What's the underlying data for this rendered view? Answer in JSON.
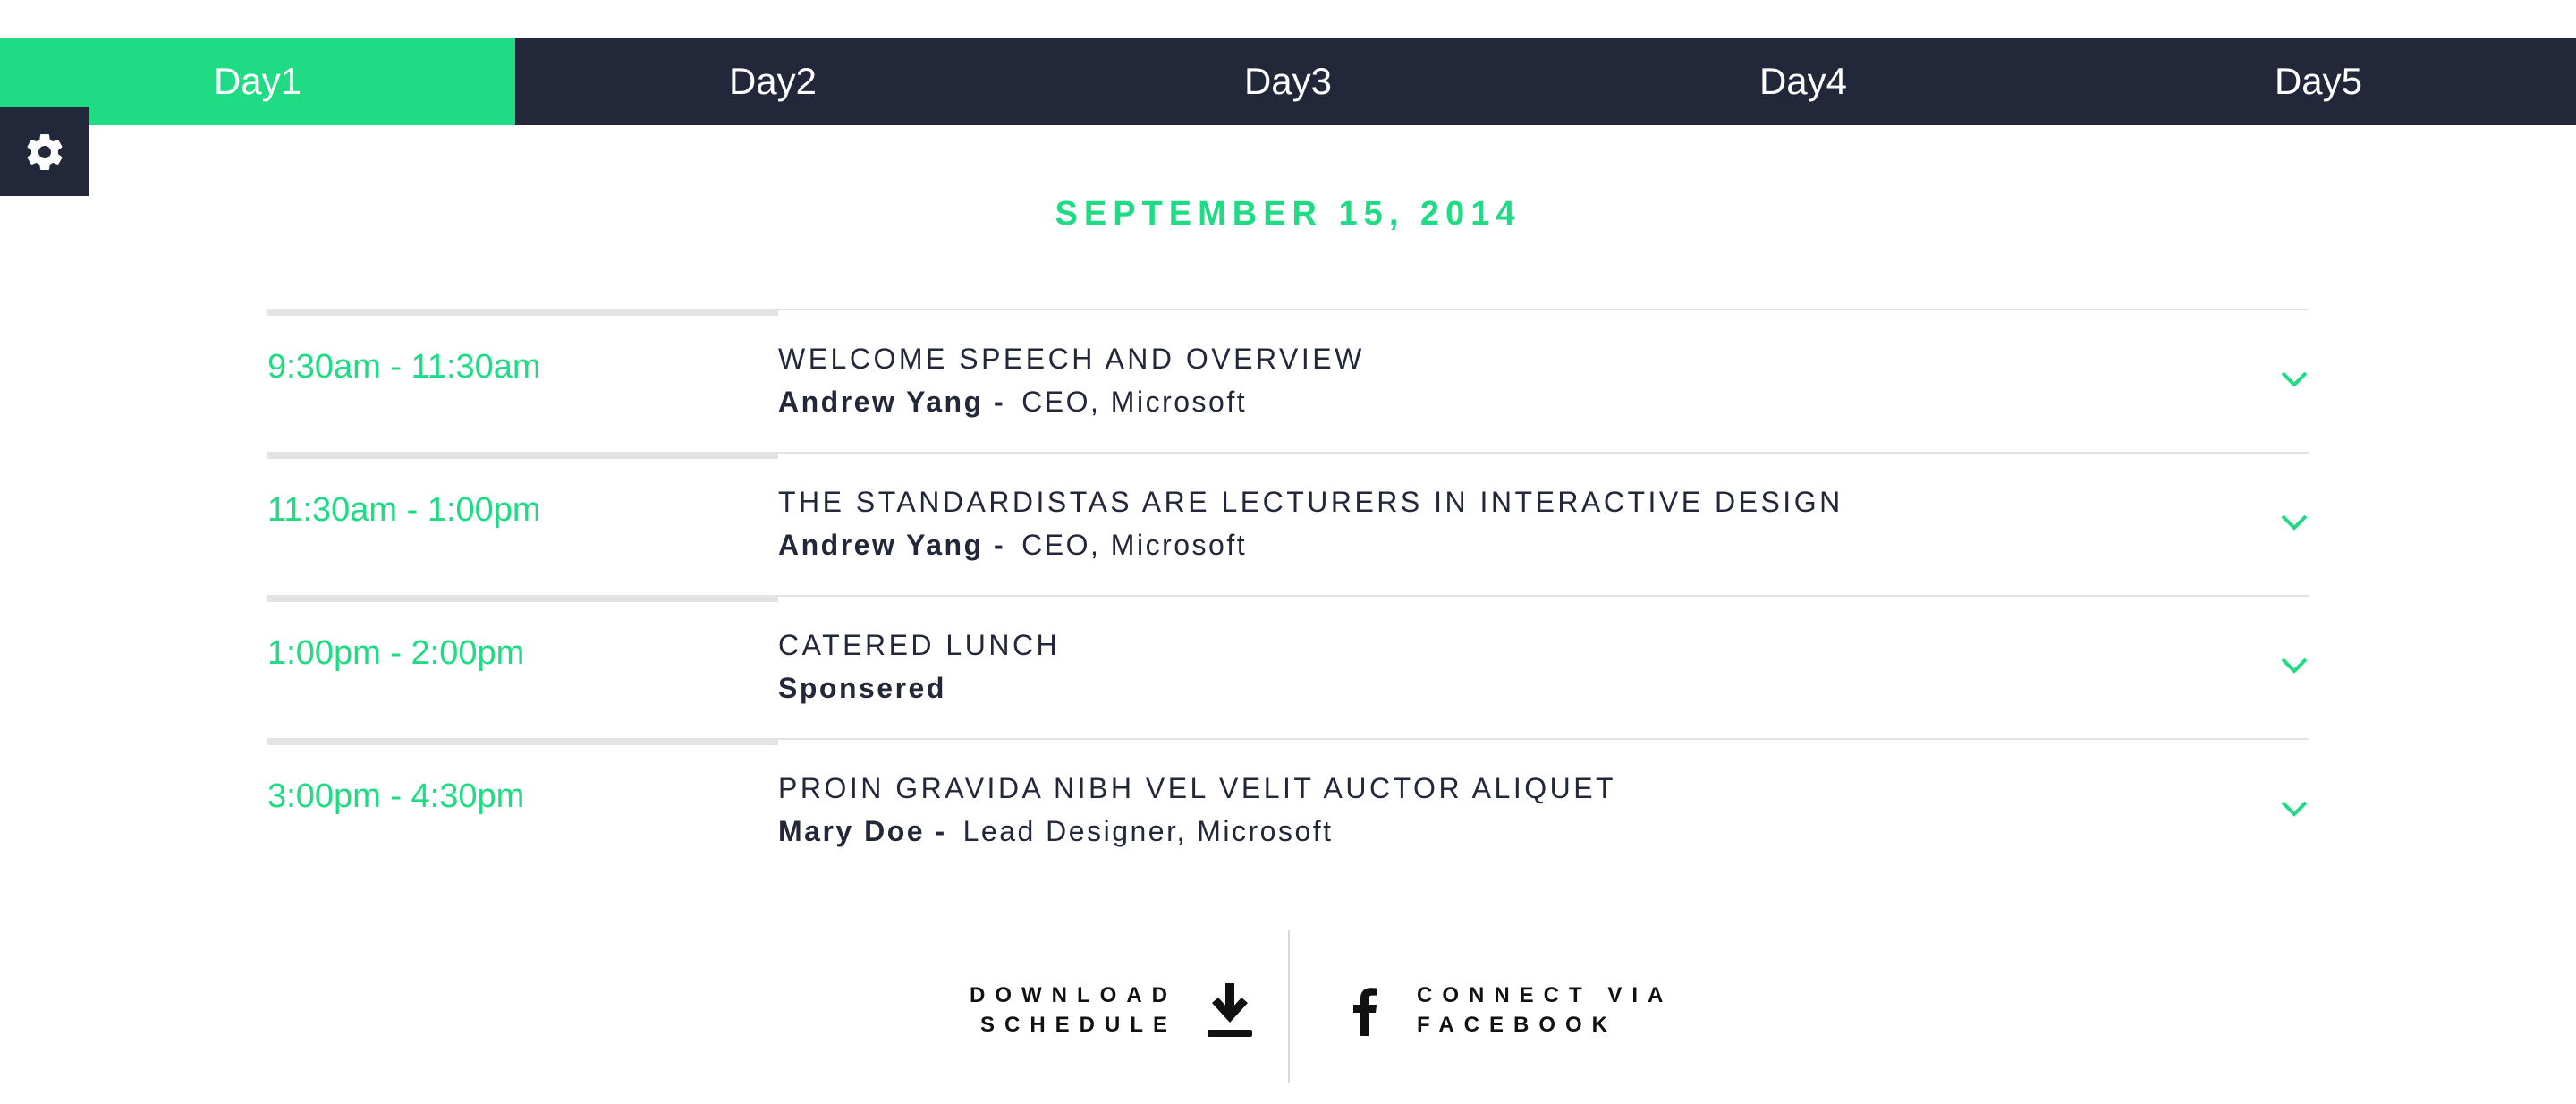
{
  "tabs": [
    {
      "label": "Day1",
      "active": true
    },
    {
      "label": "Day2",
      "active": false
    },
    {
      "label": "Day3",
      "active": false
    },
    {
      "label": "Day4",
      "active": false
    },
    {
      "label": "Day5",
      "active": false
    }
  ],
  "settings": {
    "icon": "gear-icon"
  },
  "date_title": "SEPTEMBER 15, 2014",
  "sessions": [
    {
      "time": "9:30am - 11:30am",
      "title": "WELCOME SPEECH AND OVERVIEW",
      "speaker": "Andrew Yang",
      "separator": "-",
      "role": "CEO, Microsoft"
    },
    {
      "time": "11:30am - 1:00pm",
      "title": "THE STANDARDISTAS ARE LECTURERS IN INTERACTIVE DESIGN",
      "speaker": "Andrew Yang",
      "separator": "-",
      "role": "CEO, Microsoft"
    },
    {
      "time": "1:00pm - 2:00pm",
      "title": "CATERED LUNCH",
      "speaker": "Sponsered",
      "separator": "",
      "role": ""
    },
    {
      "time": "3:00pm - 4:30pm",
      "title": "PROIN GRAVIDA NIBH VEL VELIT AUCTOR ALIQUET",
      "speaker": "Mary Doe",
      "separator": "-",
      "role": "Lead Designer, Microsoft"
    }
  ],
  "footer": {
    "download_line1": "DOWNLOAD",
    "download_line2": "SCHEDULE",
    "facebook_line1": "CONNECT VIA",
    "facebook_line2": "FACEBOOK"
  },
  "colors": {
    "accent": "#1edb84",
    "dark": "#23273a",
    "rule": "#e3e3e3"
  }
}
